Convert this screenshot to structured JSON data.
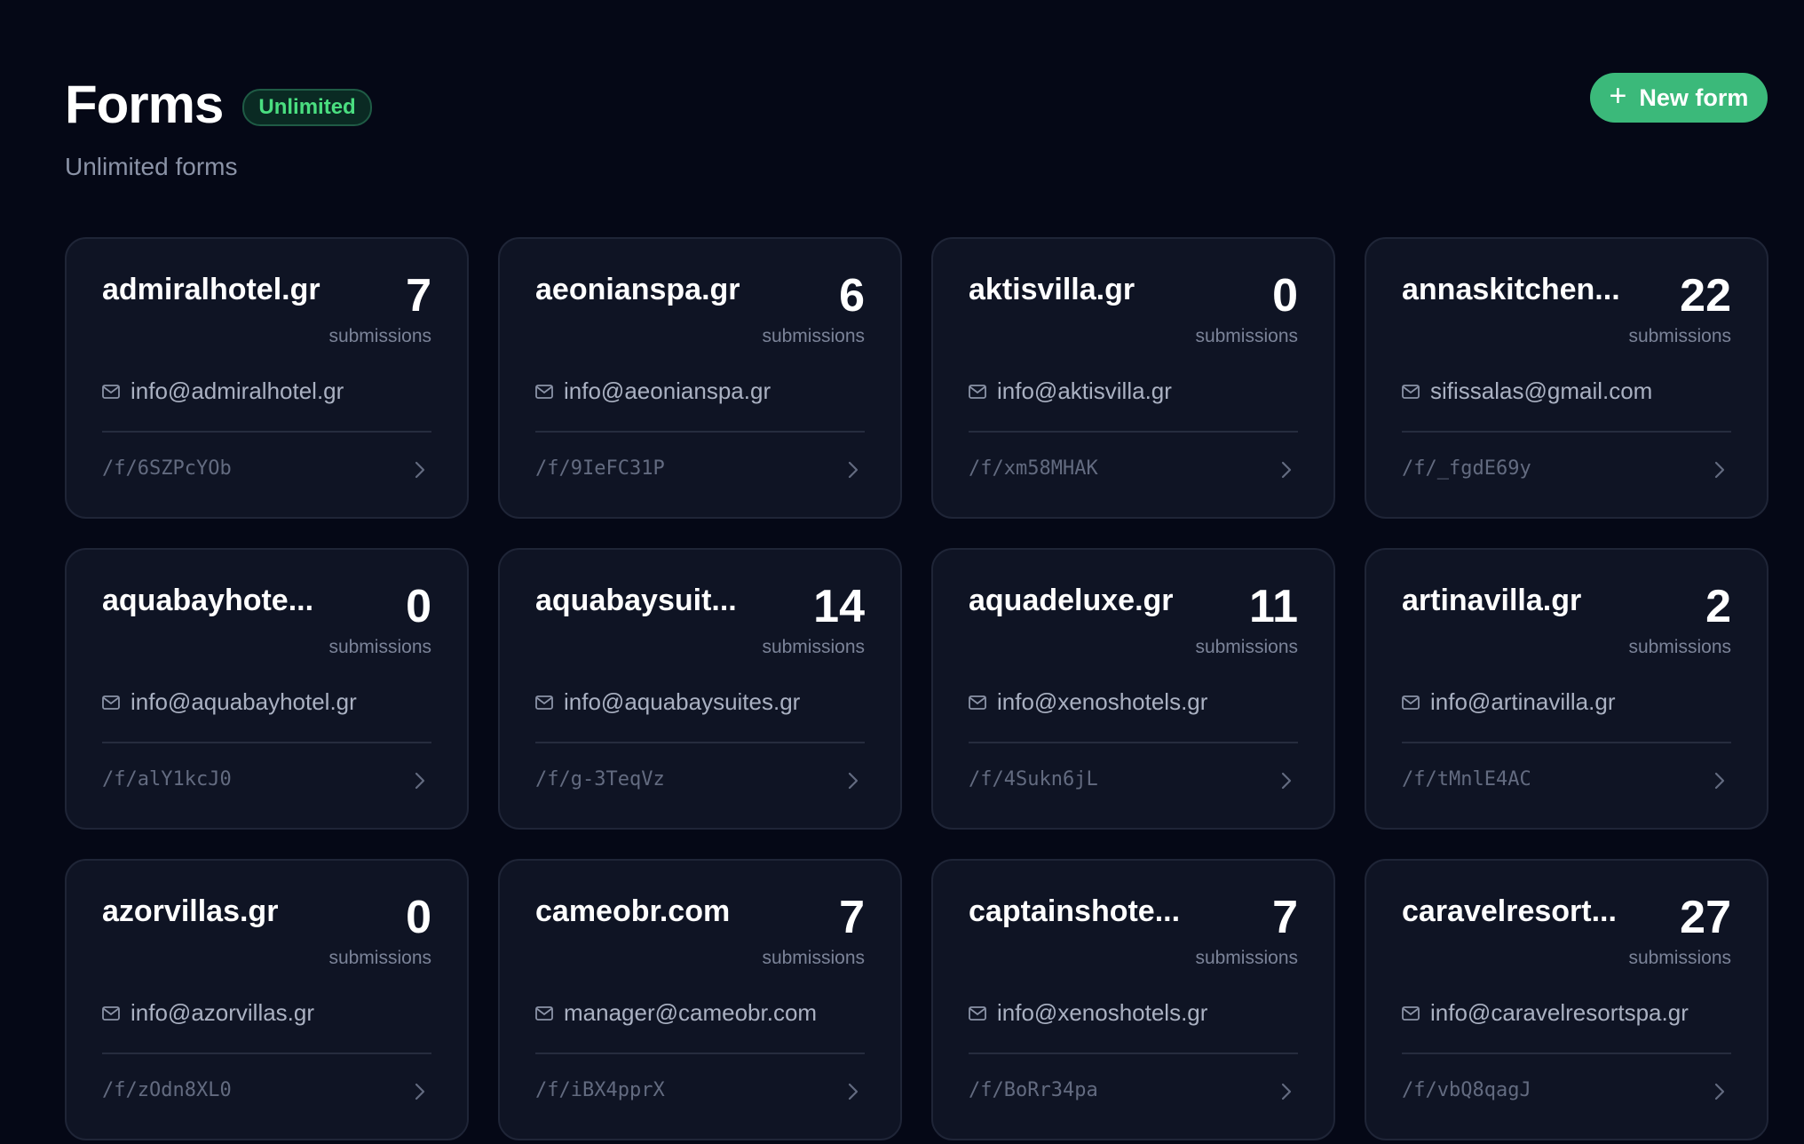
{
  "header": {
    "title": "Forms",
    "plan_badge": "Unlimited",
    "subtitle": "Unlimited forms",
    "new_form_label": "New form",
    "new_form_icon": "plus-icon"
  },
  "colors": {
    "background": "#050816",
    "card": "#0f1424",
    "accent_green": "#3bb97a",
    "badge_text": "#4ade80"
  },
  "cards": [
    {
      "name": "admiralhotel.gr",
      "count": "7",
      "count_label": "submissions",
      "email": "info@admiralhotel.gr",
      "path": "/f/6SZPcYOb"
    },
    {
      "name": "aeonianspa.gr",
      "count": "6",
      "count_label": "submissions",
      "email": "info@aeonianspa.gr",
      "path": "/f/9IeFC31P"
    },
    {
      "name": "aktisvilla.gr",
      "count": "0",
      "count_label": "submissions",
      "email": "info@aktisvilla.gr",
      "path": "/f/xm58MHAK"
    },
    {
      "name": "annaskitchen...",
      "count": "22",
      "count_label": "submissions",
      "email": "sifissalas@gmail.com",
      "path": "/f/_fgdE69y"
    },
    {
      "name": "aquabayhote...",
      "count": "0",
      "count_label": "submissions",
      "email": "info@aquabayhotel.gr",
      "path": "/f/alY1kcJ0"
    },
    {
      "name": "aquabaysuit...",
      "count": "14",
      "count_label": "submissions",
      "email": "info@aquabaysuites.gr",
      "path": "/f/g-3TeqVz"
    },
    {
      "name": "aquadeluxe.gr",
      "count": "11",
      "count_label": "submissions",
      "email": "info@xenoshotels.gr",
      "path": "/f/4Sukn6jL"
    },
    {
      "name": "artinavilla.gr",
      "count": "2",
      "count_label": "submissions",
      "email": "info@artinavilla.gr",
      "path": "/f/tMnlE4AC"
    },
    {
      "name": "azorvillas.gr",
      "count": "0",
      "count_label": "submissions",
      "email": "info@azorvillas.gr",
      "path": "/f/zOdn8XL0"
    },
    {
      "name": "cameobr.com",
      "count": "7",
      "count_label": "submissions",
      "email": "manager@cameobr.com",
      "path": "/f/iBX4pprX"
    },
    {
      "name": "captainshote...",
      "count": "7",
      "count_label": "submissions",
      "email": "info@xenoshotels.gr",
      "path": "/f/BoRr34pa"
    },
    {
      "name": "caravelresort...",
      "count": "27",
      "count_label": "submissions",
      "email": "info@caravelresortspa.gr",
      "path": "/f/vbQ8qagJ"
    }
  ]
}
